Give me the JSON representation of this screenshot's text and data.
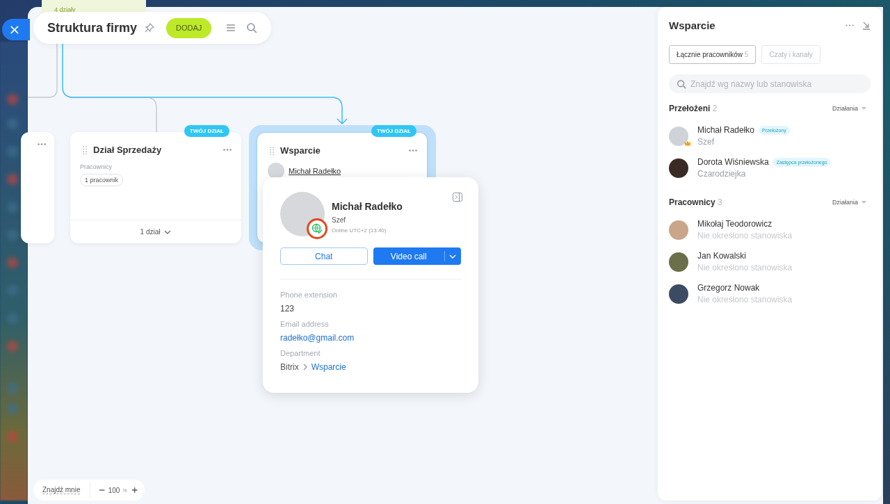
{
  "close_button": {
    "label": "×"
  },
  "toolbar": {
    "title": "Struktura firmy",
    "add_button": "DODAJ"
  },
  "canvas": {
    "top_node": {
      "label": "4 działy"
    },
    "nodes": [
      {
        "title": "Dział Sprzedaży",
        "badge": "TWÓJ DZIAŁ",
        "selected": false,
        "employees_label": "Pracownicy",
        "employee_count": "1 pracownik",
        "footer": "1 dział"
      },
      {
        "title": "Wsparcie",
        "badge": "TWÓJ DZIAŁ",
        "selected": true,
        "head": "Michał Radełko"
      }
    ]
  },
  "popup": {
    "name": "Michał Radełko",
    "position": "Szef",
    "status": "Online UTC+2 (13:40)",
    "chat_button": "Chat",
    "video_button": "Video call",
    "fields": [
      {
        "kind": "text",
        "label": "Phone extension",
        "value": "123"
      },
      {
        "kind": "link",
        "label": "Email address",
        "value": "radełko@gmail.com"
      },
      {
        "kind": "path",
        "label": "Department",
        "path": [
          "Bitrix",
          "Wsparcie"
        ]
      }
    ]
  },
  "panel": {
    "title": "Wsparcie",
    "tabs": [
      {
        "label": "Łącznie pracowników",
        "count": "5",
        "selected": true
      },
      {
        "label": "Czaty i kanały",
        "selected": false
      }
    ],
    "search": {
      "placeholder": "Znajdź wg nazwy lub stanowiska"
    },
    "sections": [
      {
        "title": "Przełożeni",
        "count": "2",
        "action": "Działania",
        "people": [
          {
            "name": "Michał Radełko",
            "role_tag": "Przełożony",
            "position": "Szef",
            "unset": false,
            "crown": true
          },
          {
            "name": "Dorota Wiśniewska",
            "role_tag": "Zastępca przełożonego",
            "position": "Czarodziejka",
            "unset": false,
            "crown": false
          }
        ]
      },
      {
        "title": "Pracownicy",
        "count": "3",
        "action": "Działania",
        "people": [
          {
            "name": "Mikołaj Teodorowicz",
            "position": "Nie określono stanowiska",
            "unset": true,
            "crown": false
          },
          {
            "name": "Jan Kowalski",
            "position": "Nie określono stanowiska",
            "unset": true,
            "crown": false
          },
          {
            "name": "Grzegorz Nowak",
            "position": "Nie określono stanowiska",
            "unset": true,
            "crown": false
          }
        ]
      }
    ]
  },
  "zoom": {
    "find_me": "Znajdź mnie",
    "value": "100",
    "unit": "%"
  }
}
